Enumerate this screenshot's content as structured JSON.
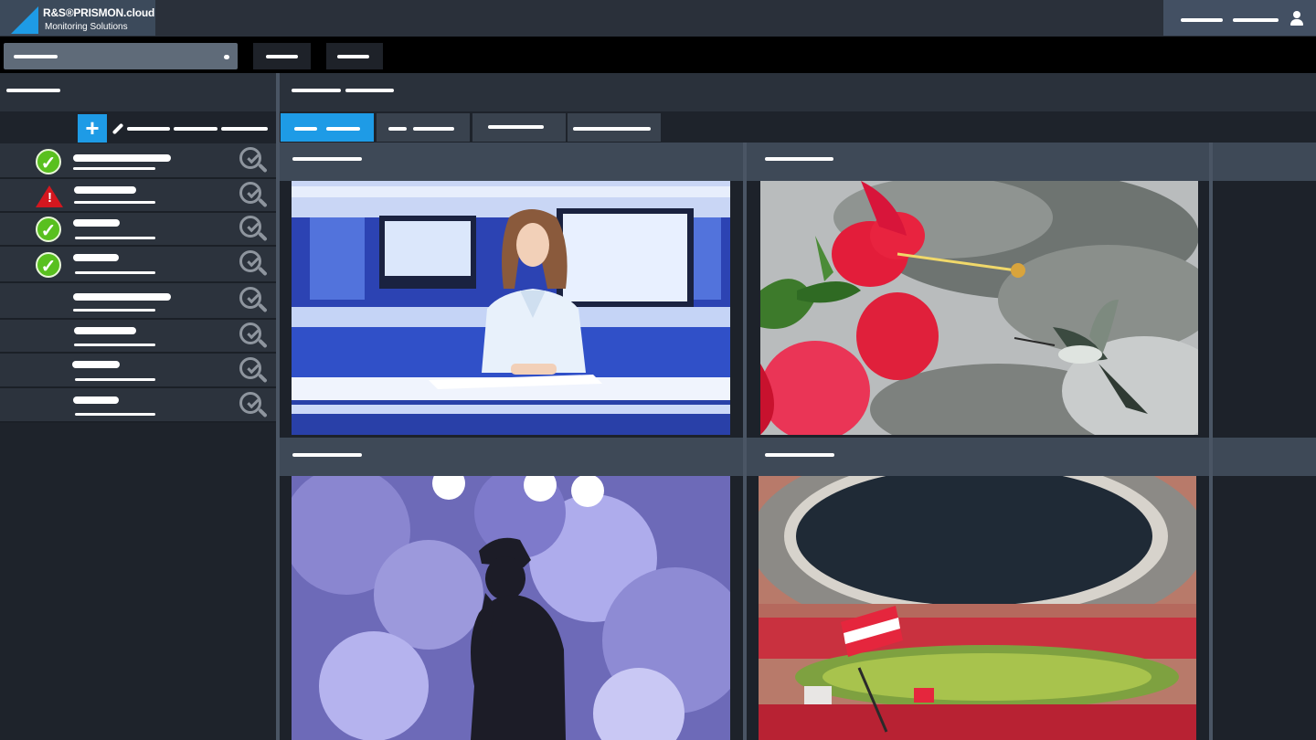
{
  "brand": {
    "title": "R&S®PRISMON.cloud",
    "subtitle": "Monitoring Solutions",
    "accent": "#1e9be6"
  },
  "icons": {
    "user": "user-icon",
    "add": "plus-icon",
    "edit": "pencil-icon",
    "inspect": "magnifier-check-icon",
    "ok": "checkmark-circle-icon",
    "warning": "warning-triangle-icon"
  },
  "sidebar": {
    "add_label": "+",
    "rows": [
      {
        "status": "ok",
        "status_glyph": "✓"
      },
      {
        "status": "warning",
        "status_glyph": "!"
      },
      {
        "status": "ok",
        "status_glyph": "✓"
      },
      {
        "status": "ok",
        "status_glyph": "✓"
      },
      {
        "status": "none"
      },
      {
        "status": "none"
      },
      {
        "status": "none"
      },
      {
        "status": "none"
      }
    ]
  },
  "tabs": {
    "active_index": 0,
    "count": 4
  },
  "tiles": [
    {
      "scene": "news-anchor-studio"
    },
    {
      "scene": "hibiscus-hummingbird"
    },
    {
      "scene": "singer-silhouette-concert"
    },
    {
      "scene": "football-stadium-crowd"
    }
  ],
  "colors": {
    "ok": "#59c01f",
    "warning": "#d4171f",
    "active_tab": "#1e9be6"
  }
}
